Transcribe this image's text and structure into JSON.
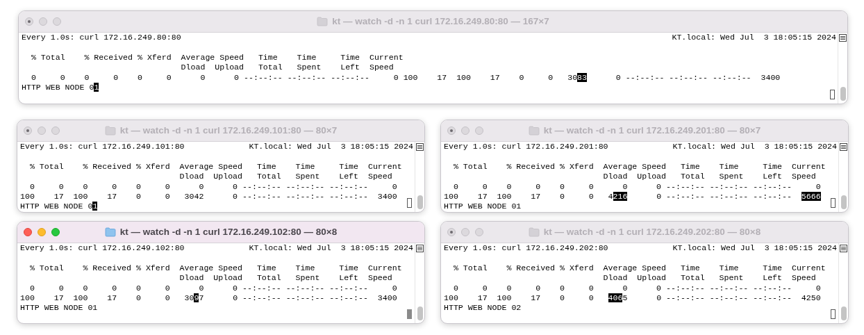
{
  "windows": [
    {
      "title": "kt — watch -d -n 1 curl 172.16.249.80:80 — 167×7",
      "active": false,
      "header_left": "Every 1.0s: curl 172.16.249.80:80",
      "header_right": "KT.local: Wed Jul  3 18:05:15 2024",
      "lines": [
        [
          {
            "text": "  % Total    % Received % Xferd  Average Speed   Time    Time     Time  Current",
            "highlighted": false
          }
        ],
        [
          {
            "text": "                                 Dload  Upload   Total   Spent    Left  Speed",
            "highlighted": false
          }
        ],
        [
          {
            "text": "  0     0    0     0    0     0      0      0 --:--:-- --:--:-- --:--:--     0 100    17  100    17    0     0   30",
            "highlighted": false
          },
          {
            "text": "83",
            "highlighted": true
          },
          {
            "text": "      0 --:--:-- --:--:-- --:--:--  3400",
            "highlighted": false
          }
        ],
        [
          {
            "text": "HTTP WEB NODE 0",
            "highlighted": false
          },
          {
            "text": "1",
            "highlighted": true
          }
        ]
      ]
    },
    {
      "title": "kt — watch -d -n 1 curl 172.16.249.101:80 — 80×7",
      "active": false,
      "header_left": "Every 1.0s: curl 172.16.249.101:80",
      "header_right": "KT.local: Wed Jul  3 18:05:15 2024",
      "lines": [
        [
          {
            "text": "  % Total    % Received % Xferd  Average Speed   Time    Time     Time  Current",
            "highlighted": false
          }
        ],
        [
          {
            "text": "                                 Dload  Upload   Total   Spent    Left  Speed",
            "highlighted": false
          }
        ],
        [
          {
            "text": "  0     0    0     0    0     0      0      0 --:--:-- --:--:-- --:--:--     0",
            "highlighted": false
          }
        ],
        [
          {
            "text": "100    17  100    17    0     0   3042      0 --:--:-- --:--:-- --:--:--  3400",
            "highlighted": false
          }
        ],
        [
          {
            "text": "HTTP WEB NODE 0",
            "highlighted": false
          },
          {
            "text": "1",
            "highlighted": true
          }
        ]
      ]
    },
    {
      "title": "kt — watch -d -n 1 curl 172.16.249.201:80 — 80×7",
      "active": false,
      "header_left": "Every 1.0s: curl 172.16.249.201:80",
      "header_right": "KT.local: Wed Jul  3 18:05:15 2024",
      "lines": [
        [
          {
            "text": "  % Total    % Received % Xferd  Average Speed   Time    Time     Time  Current",
            "highlighted": false
          }
        ],
        [
          {
            "text": "                                 Dload  Upload   Total   Spent    Left  Speed",
            "highlighted": false
          }
        ],
        [
          {
            "text": "  0     0    0     0    0     0      0      0 --:--:-- --:--:-- --:--:--     0",
            "highlighted": false
          }
        ],
        [
          {
            "text": "100    17  100    17    0     0   4",
            "highlighted": false
          },
          {
            "text": "216",
            "highlighted": true
          },
          {
            "text": "      0 --:--:-- --:--:-- --:--:--  ",
            "highlighted": false
          },
          {
            "text": "5666",
            "highlighted": true
          }
        ],
        [
          {
            "text": "HTTP WEB NODE 01",
            "highlighted": false
          }
        ]
      ]
    },
    {
      "title": "kt — watch -d -n 1 curl 172.16.249.102:80 — 80×8",
      "active": true,
      "header_left": "Every 1.0s: curl 172.16.249.102:80",
      "header_right": "KT.local: Wed Jul  3 18:05:15 2024",
      "lines": [
        [
          {
            "text": "  % Total    % Received % Xferd  Average Speed   Time    Time     Time  Current",
            "highlighted": false
          }
        ],
        [
          {
            "text": "                                 Dload  Upload   Total   Spent    Left  Speed",
            "highlighted": false
          }
        ],
        [
          {
            "text": "  0     0    0     0    0     0      0      0 --:--:-- --:--:-- --:--:--     0",
            "highlighted": false
          }
        ],
        [
          {
            "text": "100    17  100    17    0     0   30",
            "highlighted": false
          },
          {
            "text": "9",
            "highlighted": true
          },
          {
            "text": "7      0 --:--:-- --:--:-- --:--:--  3400",
            "highlighted": false
          }
        ],
        [
          {
            "text": "HTTP WEB NODE 01",
            "highlighted": false
          }
        ]
      ]
    },
    {
      "title": "kt — watch -d -n 1 curl 172.16.249.202:80 — 80×8",
      "active": false,
      "header_left": "Every 1.0s: curl 172.16.249.202:80",
      "header_right": "KT.local: Wed Jul  3 18:05:15 2024",
      "lines": [
        [
          {
            "text": "  % Total    % Received % Xferd  Average Speed   Time    Time     Time  Current",
            "highlighted": false
          }
        ],
        [
          {
            "text": "                                 Dload  Upload   Total   Spent    Left  Speed",
            "highlighted": false
          }
        ],
        [
          {
            "text": "  0     0    0     0    0     0      0      0 --:--:-- --:--:-- --:--:--     0",
            "highlighted": false
          }
        ],
        [
          {
            "text": "100    17  100    17    0     0   ",
            "highlighted": false
          },
          {
            "text": "406",
            "highlighted": true
          },
          {
            "text": "5      0 --:--:-- --:--:-- --:--:--  4250",
            "highlighted": false
          }
        ],
        [
          {
            "text": "HTTP WEB NODE 02",
            "highlighted": false
          }
        ]
      ]
    }
  ]
}
